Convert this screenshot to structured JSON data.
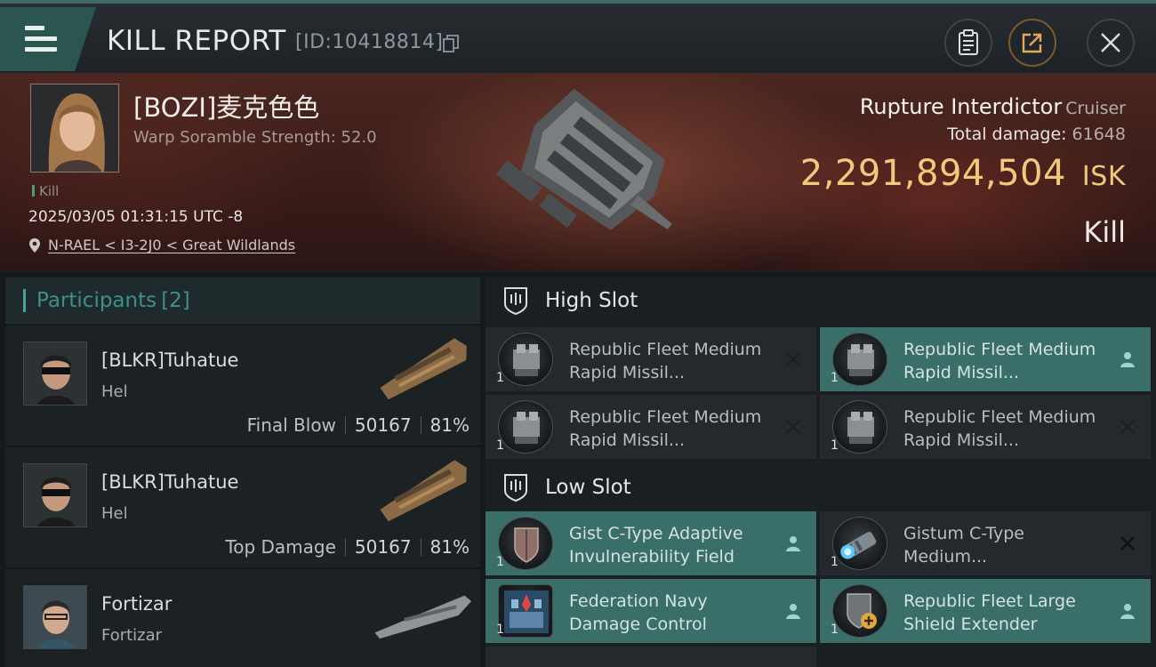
{
  "header": {
    "title": "KILL REPORT",
    "report_id": "[ID:10418814]"
  },
  "victim": {
    "name": "[BOZI]麦克色色",
    "scramble": "Warp Soramble Strength: 52.0",
    "tag": "Kill",
    "timestamp": "2025/03/05 01:31:15 UTC -8",
    "location": "N-RAEL < I3-2J0 < Great Wildlands",
    "ship_name": "Rupture Interdictor",
    "ship_class": "Cruiser",
    "total_damage_label": "Total damage:",
    "total_damage_value": "61648",
    "isk_value": "2,291,894,504",
    "isk_unit": "ISK",
    "result": "Kill"
  },
  "participants": {
    "label": "Participants",
    "count": "[2]",
    "rows": [
      {
        "name": "[BLKR]Tuhatue",
        "ship": "Hel",
        "role": "Final Blow",
        "damage": "50167",
        "percent": "81%"
      },
      {
        "name": "[BLKR]Tuhatue",
        "ship": "Hel",
        "role": "Top Damage",
        "damage": "50167",
        "percent": "81%"
      },
      {
        "name": "Fortizar",
        "ship": "Fortizar"
      }
    ]
  },
  "fittings": {
    "high_slot_label": "High Slot",
    "low_slot_label": "Low Slot",
    "high": [
      {
        "name": "Republic Fleet Medium Rapid Missil...",
        "qty": "1",
        "status": "destroyed",
        "icon": "missile-launcher-icon"
      },
      {
        "name": "Republic Fleet Medium Rapid Missil...",
        "qty": "1",
        "status": "dropped",
        "icon": "missile-launcher-icon"
      },
      {
        "name": "Republic Fleet Medium Rapid Missil...",
        "qty": "1",
        "status": "destroyed",
        "icon": "missile-launcher-icon"
      },
      {
        "name": "Republic Fleet Medium Rapid Missil...",
        "qty": "1",
        "status": "destroyed",
        "icon": "missile-launcher-icon"
      }
    ],
    "low": [
      {
        "name": "Gist C-Type Adaptive Invulnerability Field",
        "qty": "1",
        "status": "dropped",
        "icon": "shield-hardener-icon"
      },
      {
        "name": "Gistum C-Type Medium...",
        "qty": "1",
        "status": "destroyed",
        "icon": "shield-booster-icon"
      },
      {
        "name": "Federation Navy Damage Control",
        "qty": "1",
        "status": "dropped",
        "icon": "damage-control-icon"
      },
      {
        "name": "Republic Fleet Large Shield Extender",
        "qty": "1",
        "status": "dropped",
        "icon": "shield-extender-icon"
      }
    ]
  },
  "colors": {
    "accent": "#3a6f69",
    "isk": "#f2c97c",
    "dropped_highlight": "#3a6f69"
  }
}
